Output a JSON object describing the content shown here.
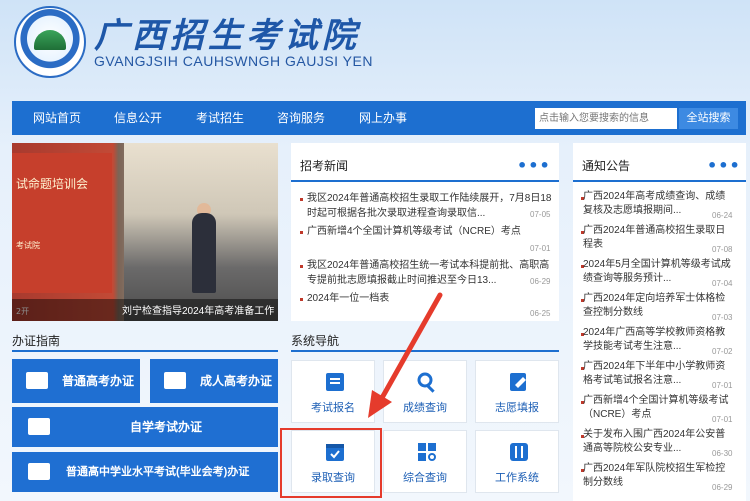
{
  "header": {
    "title": "广西招生考试院",
    "subtitle": "GVANGJSIH CAUHSWNGH GAUJSI YEN"
  },
  "nav": {
    "items": [
      "网站首页",
      "信息公开",
      "考试招生",
      "咨询服务",
      "网上办事"
    ],
    "search_placeholder": "点击输入您要搜索的信息",
    "search_button": "全站搜索"
  },
  "slider": {
    "banner_text": "试命题培训会",
    "banner_small": "考试院",
    "banner_small2": "2开",
    "caption": "刘宁检查指导2024年高考准备工作"
  },
  "news": {
    "title": "招考新闻",
    "items": [
      {
        "text": "我区2024年普通高校招生录取工作陆续展开，7月8日18时起可根据各批次录取进程查询录取信...",
        "date": "07-05"
      },
      {
        "text": "广西新增4个全国计算机等级考试（NCRE）考点",
        "date": "07-01"
      },
      {
        "text": "我区2024年普通高校招生统一考试本科提前批、高职高专提前批志愿填报截止时间推迟至今日13...",
        "date": "06-29"
      },
      {
        "text": "2024年一位一档表",
        "date": "06-25"
      }
    ]
  },
  "notices": {
    "title": "通知公告",
    "items": [
      {
        "text": "广西2024年高考成绩查询、成绩复核及志愿填报期间...",
        "date": "06-24"
      },
      {
        "text": "广西2024年普通高校招生录取日程表",
        "date": "07-08"
      },
      {
        "text": "2024年5月全国计算机等级考试成绩查询等服务预计...",
        "date": "07-04"
      },
      {
        "text": "广西2024年定向培养军士体格检查控制分数线",
        "date": "07-03"
      },
      {
        "text": "2024年广西高等学校教师资格教学技能考试考生注意...",
        "date": "07-02"
      },
      {
        "text": "广西2024年下半年中小学教师资格考试笔试报名注意...",
        "date": "07-01"
      },
      {
        "text": "广西新增4个全国计算机等级考试（NCRE）考点",
        "date": "07-01"
      },
      {
        "text": "关于发布入围广西2024年公安普通高等院校公安专业...",
        "date": "06-30"
      },
      {
        "text": "广西2024年军队院校招生军检控制分数线",
        "date": "06-29"
      }
    ]
  },
  "guide": {
    "title": "办证指南",
    "buttons": [
      "普通高考办证",
      "成人高考办证",
      "自学考试办证",
      "普通高中学业水平考试(毕业会考)办证"
    ]
  },
  "system_nav": {
    "title": "系统导航",
    "tiles": [
      "考试报名",
      "成绩查询",
      "志愿填报",
      "录取查询",
      "综合查询",
      "工作系统"
    ]
  },
  "colors": {
    "nav_blue": "#1d6fd0",
    "highlight_red": "#e53b2c"
  }
}
